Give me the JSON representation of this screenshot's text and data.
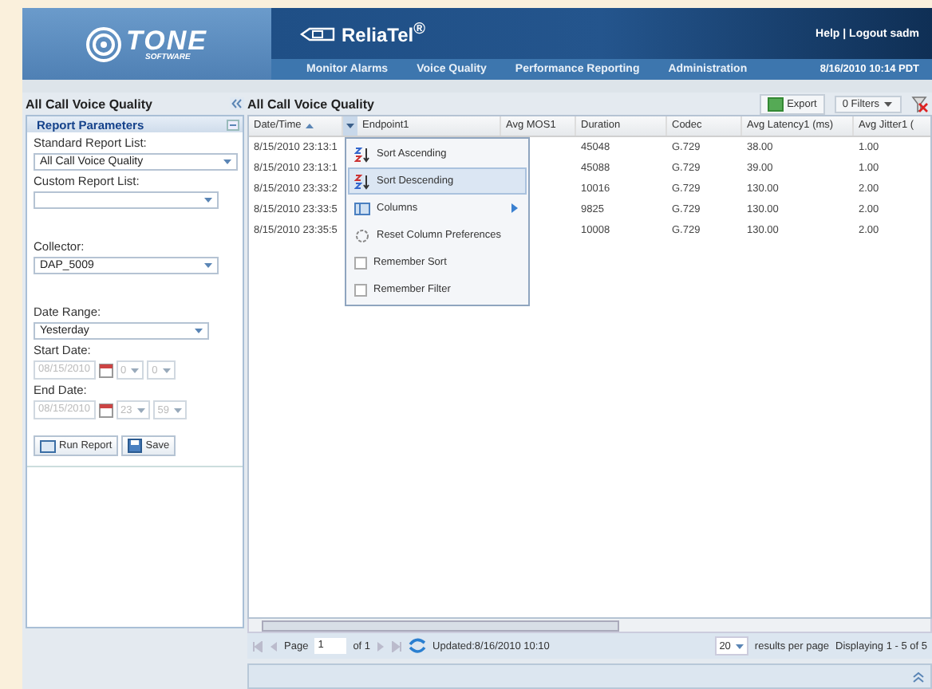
{
  "logo": {
    "name": "TONE",
    "sub": "SOFTWARE"
  },
  "product": "ReliaTel$^{®}$",
  "header_links": "Help | Logout sadm",
  "nav": [
    "Monitor Alarms",
    "Voice Quality",
    "Performance Reporting",
    "Administration"
  ],
  "datetime": "8/16/2010 10:14 PDT",
  "left_panel": {
    "title": "All Call Voice Quality",
    "section": "Report Parameters",
    "standard_report_list": {
      "label": "Standard Report List:",
      "value": "All Call Voice Quality"
    },
    "custom_report_list": {
      "label": "Custom Report List:"
    },
    "collector": {
      "label": "Collector:",
      "value": "DAP_5009"
    },
    "date_range": {
      "label": "Date Range:",
      "value": "Yesterday"
    },
    "start_date": {
      "label": "Start Date:",
      "date": "08/15/2010",
      "hour": "0",
      "minute": "0",
      "disabled": true
    },
    "end_date": {
      "label": "End Date:",
      "date": "08/15/2010",
      "hour": "23",
      "minute": "59",
      "disabled": true
    },
    "buttons": [
      "Run Report",
      "Save"
    ]
  },
  "grid": {
    "title": "All Call Voice Quality",
    "export": "Export",
    "filters": "0 Filters",
    "columns": [
      {
        "label": "Date/Time",
        "sorted_ascending": true
      },
      {
        "label": "Endpoint1",
        "sorted_ascending": false
      },
      {
        "label": "Avg MOS1",
        "sorted_ascending": false
      },
      {
        "label": "Duration",
        "sorted_ascending": false
      },
      {
        "label": "Codec",
        "sorted_ascending": false
      },
      {
        "label": "Avg Latency1 (ms)",
        "sorted_ascending": false
      },
      {
        "label": "Avg Jitter1 (",
        "sorted_ascending": false
      }
    ],
    "rows": [
      [
        "8/15/2010 23:13:1",
        "",
        "",
        "45048",
        "G.729",
        "38.00",
        "1.00"
      ],
      [
        "8/15/2010 23:13:1",
        "",
        "",
        "45088",
        "G.729",
        "39.00",
        "1.00"
      ],
      [
        "8/15/2010 23:33:2",
        "",
        "",
        "10016",
        "G.729",
        "130.00",
        "2.00"
      ],
      [
        "8/15/2010 23:33:5",
        "",
        "",
        "9825",
        "G.729",
        "130.00",
        "2.00"
      ],
      [
        "8/15/2010 23:35:5",
        "",
        "",
        "10008",
        "G.729",
        "130.00",
        "2.00"
      ]
    ],
    "menu": [
      {
        "kind": "sort-asc",
        "label": "Sort Ascending",
        "highlighted": false
      },
      {
        "kind": "sort-desc",
        "label": "Sort Descending",
        "highlighted": true
      },
      {
        "kind": "submenu",
        "label": "Columns",
        "highlighted": false
      },
      {
        "kind": "reset",
        "label": "Reset Column Preferences",
        "highlighted": false
      },
      {
        "kind": "check",
        "label": "Remember Sort",
        "highlighted": false,
        "checked": false
      },
      {
        "kind": "check",
        "label": "Remember Filter",
        "highlighted": false,
        "checked": false
      }
    ],
    "pager": {
      "page_label": "Page",
      "page": "1",
      "of": "of 1",
      "updated": "Updated:8/16/2010 10:10",
      "per_page": "20",
      "per_page_label": "results per page",
      "displaying": "Displaying 1 - 5 of 5"
    }
  }
}
